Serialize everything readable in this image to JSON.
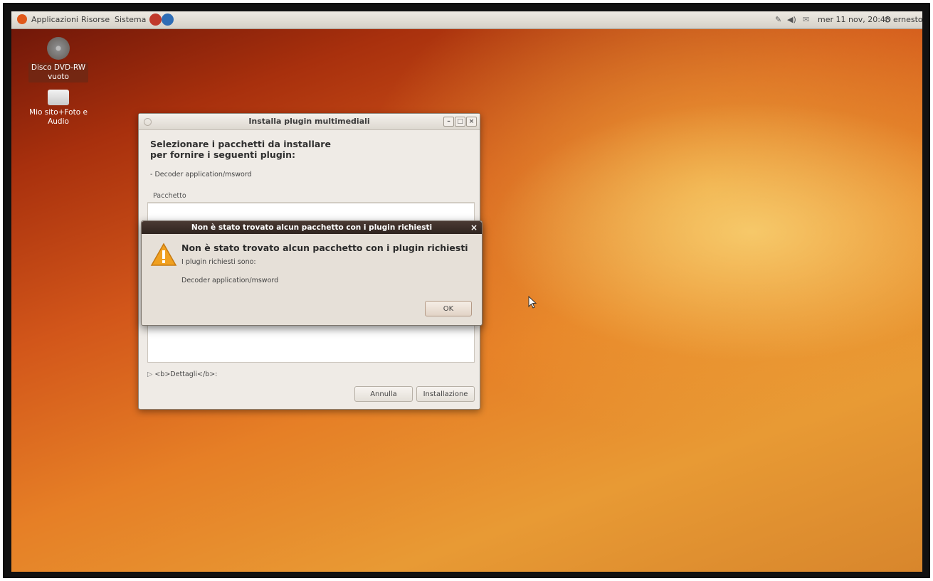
{
  "topbar": {
    "menu_applications": "Applicazioni",
    "menu_places": "Risorse",
    "menu_system": "Sistema",
    "clock": "mer 11 nov, 20:48",
    "user": "ernesto"
  },
  "desktop": {
    "icons": [
      {
        "label_line1": "Disco DVD-RW",
        "label_line2": "vuoto",
        "icon": "disc-icon"
      },
      {
        "label_line1": "Mio sito+Foto e",
        "label_line2": "Audio",
        "icon": "drive-icon"
      }
    ]
  },
  "install_window": {
    "title": "Installa plugin multimediali",
    "heading_line1": "Selezionare i pacchetti da installare",
    "heading_line2": "per fornire i seguenti plugin:",
    "required_plugin": "- Decoder application/msword",
    "column_header": "Pacchetto",
    "details_label": "<b>Dettagli</b>:",
    "cancel_label": "Annulla",
    "install_label": "Installazione"
  },
  "error_dialog": {
    "title": "Non è stato trovato alcun pacchetto con i plugin richiesti",
    "heading": "Non è stato trovato alcun pacchetto con i plugin richiesti",
    "text_line1": "I plugin richiesti sono:",
    "text_line2": "Decoder application/msword",
    "ok_label": "OK"
  },
  "colors": {
    "accent_orange": "#e0581a",
    "dialog_titlebar": "#3a2c26",
    "warning": "#f0a020"
  }
}
